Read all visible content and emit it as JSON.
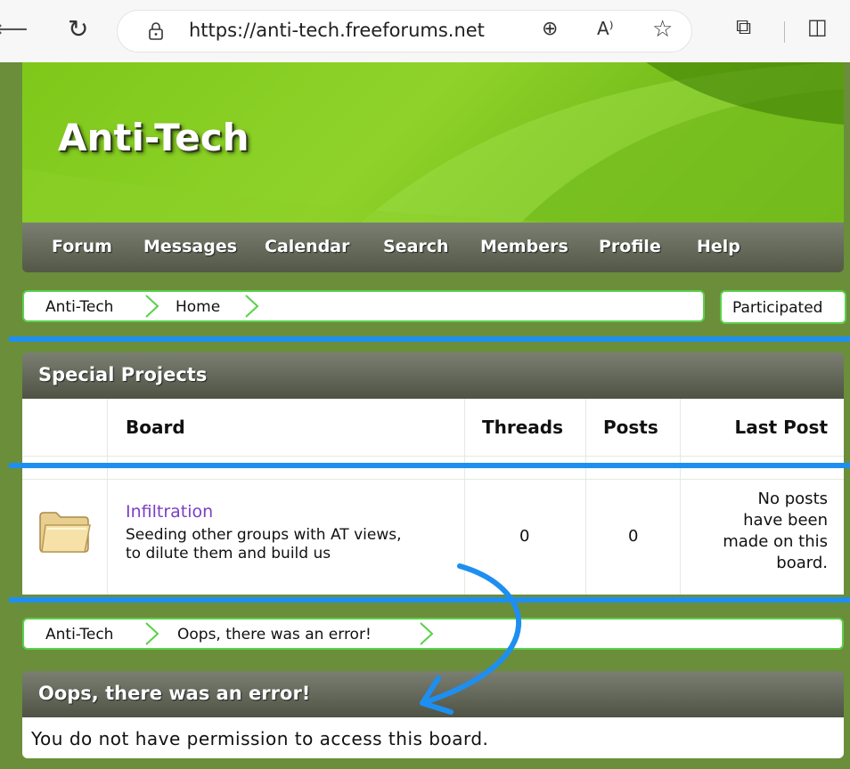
{
  "browser": {
    "url": "https://anti-tech.freeforums.net",
    "back_glyph": "⟵",
    "refresh_glyph": "↻",
    "lock_glyph": "🔒",
    "zoom_glyph": "⊕",
    "read_glyph": "A⁾",
    "star_glyph": "☆",
    "ext_glyph": "⧉",
    "split_glyph": "◫"
  },
  "site": {
    "title": "Anti-Tech"
  },
  "nav": {
    "items": [
      "Forum",
      "Messages",
      "Calendar",
      "Search",
      "Members",
      "Profile",
      "Help"
    ]
  },
  "breadcrumb_top": {
    "items": [
      "Anti-Tech",
      "Home"
    ]
  },
  "participated_label": "Participated",
  "category": {
    "title": "Special Projects",
    "columns": {
      "board": "Board",
      "threads": "Threads",
      "posts": "Posts",
      "last_post": "Last Post"
    },
    "boards": [
      {
        "name": "Infiltration",
        "description_line1": "Seeding other groups with AT views,",
        "description_line2": "to dilute them and build us",
        "threads": "0",
        "posts": "0",
        "last_post_lines": [
          "No posts",
          "have been",
          "made on this",
          "board."
        ]
      }
    ]
  },
  "breadcrumb_bottom": {
    "items": [
      "Anti-Tech",
      "Oops, there was an error!"
    ]
  },
  "error": {
    "title": "Oops, there was an error!",
    "message": "You do not have permission to access this board."
  },
  "colors": {
    "annotation_blue": "#1e8ff0",
    "link_purple": "#7b3fc6",
    "accent_green": "#5bd04a"
  }
}
